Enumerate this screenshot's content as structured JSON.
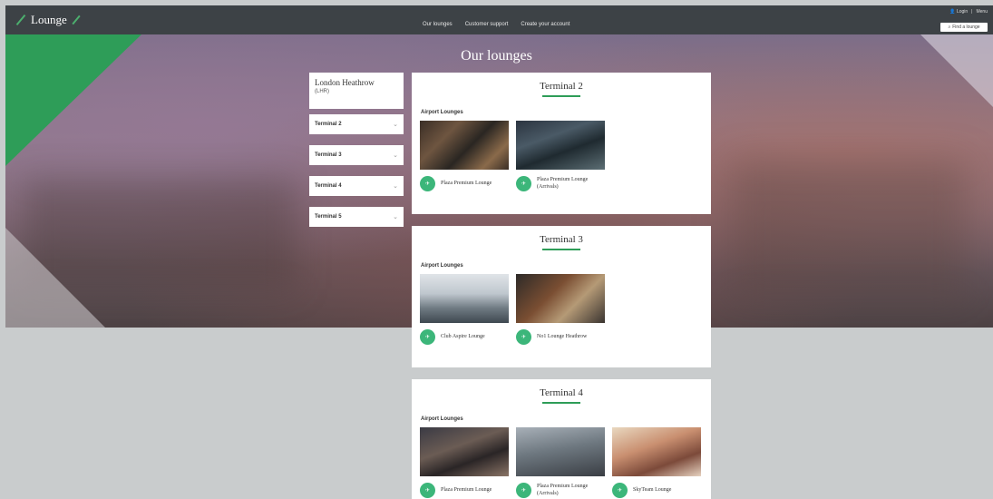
{
  "header": {
    "logo_text": "Lounge",
    "nav": [
      "Our lounges",
      "Customer support",
      "Create your account"
    ],
    "util": [
      "Login",
      "Menu"
    ],
    "find_button": "Find a lounge"
  },
  "page_title": "Our lounges",
  "airport": {
    "name": "London Heathrow",
    "code": "(LHR)"
  },
  "terminals": [
    {
      "label": "Terminal 2"
    },
    {
      "label": "Terminal 3"
    },
    {
      "label": "Terminal 4"
    },
    {
      "label": "Terminal 5"
    }
  ],
  "cards": [
    {
      "title": "Terminal 2",
      "section": "Airport Lounges",
      "lounges": [
        {
          "name": "Plaza Premium Lounge"
        },
        {
          "name": "Plaza Premium Lounge (Arrivals)"
        }
      ]
    },
    {
      "title": "Terminal 3",
      "section": "Airport Lounges",
      "lounges": [
        {
          "name": "Club Aspire Lounge"
        },
        {
          "name": "No1 Lounge Heathrow"
        }
      ]
    },
    {
      "title": "Terminal 4",
      "section": "Airport Lounges",
      "lounges": [
        {
          "name": "Plaza Premium Lounge"
        },
        {
          "name": "Plaza Premium Lounge (Arrivals)"
        },
        {
          "name": "SkyTeam Lounge"
        }
      ]
    }
  ],
  "colors": {
    "brand_green": "#2e9d58",
    "icon_green": "#3cb67a",
    "header": "#3d4246"
  }
}
